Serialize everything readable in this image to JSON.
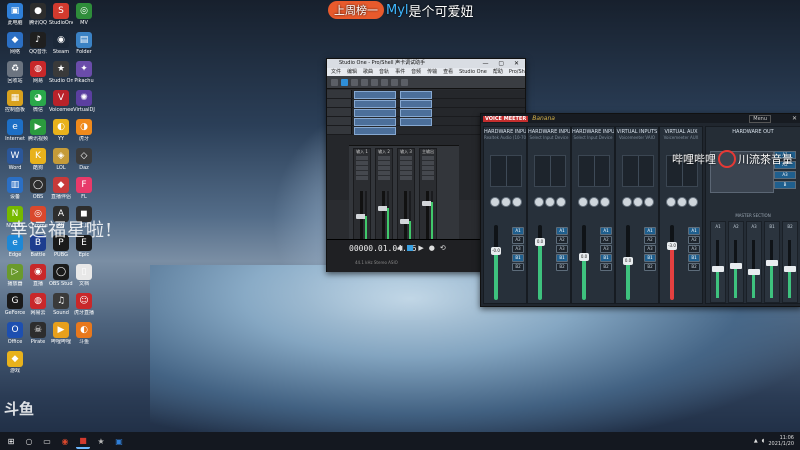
{
  "overlay": {
    "banner_tag": "上周榜一",
    "banner_name": "Myl",
    "banner_text": "是个可爱妞",
    "watermark": "幸运福星啦!",
    "platform": "斗鱼",
    "bili_text_a": "哔哩哔哩",
    "bili_text_b": "川流茶音量"
  },
  "desktop": {
    "icons": [
      {
        "label": "此电脑",
        "glyph": "▣",
        "color": "#2f7fd8"
      },
      {
        "label": "腾讯QQ",
        "glyph": "●",
        "color": "#2d2d2d"
      },
      {
        "label": "StudioOne",
        "glyph": "S",
        "color": "#d23a2e"
      },
      {
        "label": "MV",
        "glyph": "◎",
        "color": "#2e8d3a"
      },
      {
        "label": "网络",
        "glyph": "◆",
        "color": "#2b6fc4"
      },
      {
        "label": "QQ音乐",
        "glyph": "♪",
        "color": "#1f1f1f"
      },
      {
        "label": "Steam",
        "glyph": "◉",
        "color": "#1b2838"
      },
      {
        "label": "Folder",
        "glyph": "▤",
        "color": "#3b82c4"
      },
      {
        "label": "回收站",
        "glyph": "♻",
        "color": "#6b7480"
      },
      {
        "label": "网易",
        "glyph": "◍",
        "color": "#c8282a"
      },
      {
        "label": "Studio One",
        "glyph": "★",
        "color": "#3a3a3a"
      },
      {
        "label": "Pikachu",
        "glyph": "✦",
        "color": "#6a4caa"
      },
      {
        "label": "控制面板",
        "glyph": "▦",
        "color": "#d9a21e"
      },
      {
        "label": "微信",
        "glyph": "◕",
        "color": "#2aa84a"
      },
      {
        "label": "Voicemeeter",
        "glyph": "V",
        "color": "#b9222a"
      },
      {
        "label": "VirtualDJ",
        "glyph": "✺",
        "color": "#5b3fa0"
      },
      {
        "label": "Internet",
        "glyph": "e",
        "color": "#1d6fc5"
      },
      {
        "label": "腾讯视频",
        "glyph": "▶",
        "color": "#2b9b3e"
      },
      {
        "label": "YY",
        "glyph": "◐",
        "color": "#e8b21c"
      },
      {
        "label": "虎牙",
        "glyph": "◑",
        "color": "#f08a1c"
      },
      {
        "label": "Word",
        "glyph": "W",
        "color": "#2b579a"
      },
      {
        "label": "酷狗",
        "glyph": "K",
        "color": "#e8b21c"
      },
      {
        "label": "LOL",
        "glyph": "◈",
        "color": "#c59b39"
      },
      {
        "label": "Daz",
        "glyph": "◇",
        "color": "#3b3b3b"
      },
      {
        "label": "设备",
        "glyph": "▥",
        "color": "#2b6fc4"
      },
      {
        "label": "OBS",
        "glyph": "◯",
        "color": "#2d2d2d"
      },
      {
        "label": "直播伴侣",
        "glyph": "◆",
        "color": "#c83a3a"
      },
      {
        "label": "FL",
        "glyph": "F",
        "color": "#e83a6a"
      },
      {
        "label": "NVIDIA",
        "glyph": "N",
        "color": "#76b900"
      },
      {
        "label": "Chrome",
        "glyph": "◎",
        "color": "#d9482d"
      },
      {
        "label": "AU",
        "glyph": "A",
        "color": "#2d2d2d"
      },
      {
        "label": "工具",
        "glyph": "◼",
        "color": "#2d2d2d"
      },
      {
        "label": "Edge",
        "glyph": "e",
        "color": "#1e88d6"
      },
      {
        "label": "Battle",
        "glyph": "B",
        "color": "#1d3d8f"
      },
      {
        "label": "PUBG",
        "glyph": "P",
        "color": "#1a1a1a"
      },
      {
        "label": "Epic",
        "glyph": "E",
        "color": "#1a1a1a"
      },
      {
        "label": "播放器",
        "glyph": "▷",
        "color": "#6a9a2d"
      },
      {
        "label": "直播",
        "glyph": "◉",
        "color": "#c8282a"
      },
      {
        "label": "OBS Studio",
        "glyph": "◯",
        "color": "#1a1a1a"
      },
      {
        "label": "文档",
        "glyph": "▯",
        "color": "#e8e8e8"
      },
      {
        "label": "GeForce",
        "glyph": "G",
        "color": "#1a1a1a"
      },
      {
        "label": "网易云",
        "glyph": "◍",
        "color": "#c8282a"
      },
      {
        "label": "Sound",
        "glyph": "♫",
        "color": "#3a3a3a"
      },
      {
        "label": "虎牙直播",
        "glyph": "☺",
        "color": "#c8282a"
      },
      {
        "label": "Office",
        "glyph": "O",
        "color": "#1d4fb0"
      },
      {
        "label": "Pirate",
        "glyph": "☠",
        "color": "#2d2d2d"
      },
      {
        "label": "哔哩哔哩",
        "glyph": "▶",
        "color": "#e8a01c"
      },
      {
        "label": "斗鱼",
        "glyph": "◐",
        "color": "#e8781c"
      },
      {
        "label": "游戏",
        "glyph": "◆",
        "color": "#e8b21c"
      }
    ]
  },
  "studio_one": {
    "title": "Studio One - Pro/Shell 声卡调试助手",
    "menu": [
      "文件",
      "编辑",
      "歌曲",
      "音轨",
      "事件",
      "音频",
      "传输",
      "查看",
      "Studio One",
      "帮助",
      "Pro/Shell 声卡调试助手"
    ],
    "channels": [
      {
        "name": "输入 1",
        "level": 0.55
      },
      {
        "name": "输入 2",
        "level": 0.7
      },
      {
        "name": "输入 3",
        "level": 0.45
      },
      {
        "name": "主输出",
        "level": 0.8
      }
    ],
    "time": "00000.01.04.16",
    "transport_sub": "44.1 kHz  Stereo ASIO",
    "window_controls": "— ▢ ✕"
  },
  "voicemeeter": {
    "logo": "VOICE MEETER",
    "brand": "Banana",
    "menu": "Menu",
    "close": "✕",
    "strips": [
      {
        "title": "HARDWARE INPUT 1",
        "sub": "Realtek Audio (10-70 O)",
        "level": 0.65,
        "cap": "-0.0",
        "red": false
      },
      {
        "title": "HARDWARE INPUT 2",
        "sub": "Select Input Device",
        "level": 0.78,
        "cap": "0.0",
        "red": false
      },
      {
        "title": "HARDWARE INPUT 3",
        "sub": "Select Input Device",
        "level": 0.58,
        "cap": "0.0",
        "red": false
      },
      {
        "title": "VIRTUAL INPUTS",
        "sub": "Voicemeeter VAIO",
        "level": 0.52,
        "cap": "0.0",
        "red": false
      },
      {
        "title": "VIRTUAL AUX",
        "sub": "Voicemeeter AUX",
        "level": 0.72,
        "cap": "-3.0",
        "red": true
      }
    ],
    "bus_labels": [
      "A1",
      "A2",
      "A3",
      "B1",
      "B2"
    ],
    "right_header": "HARDWARE OUT",
    "master_label": "MASTER SECTION",
    "outputs": [
      {
        "label": "A1",
        "level": 0.5
      },
      {
        "label": "A2",
        "level": 0.55
      },
      {
        "label": "A3",
        "level": 0.45
      },
      {
        "label": "B1",
        "level": 0.6
      },
      {
        "label": "B2",
        "level": 0.5
      }
    ]
  },
  "taskbar": {
    "items": [
      {
        "glyph": "⊞",
        "color": "#ffffff"
      },
      {
        "glyph": "○",
        "color": "#dddddd"
      },
      {
        "glyph": "▭",
        "color": "#dddddd"
      },
      {
        "glyph": "◉",
        "color": "#d9482d"
      },
      {
        "glyph": "■",
        "color": "#d23a2e"
      },
      {
        "glyph": "★",
        "color": "#bbbbbb"
      },
      {
        "glyph": "▣",
        "color": "#2f7fd8"
      }
    ],
    "clock_time": "11:06",
    "clock_date": "2021/1/20"
  }
}
